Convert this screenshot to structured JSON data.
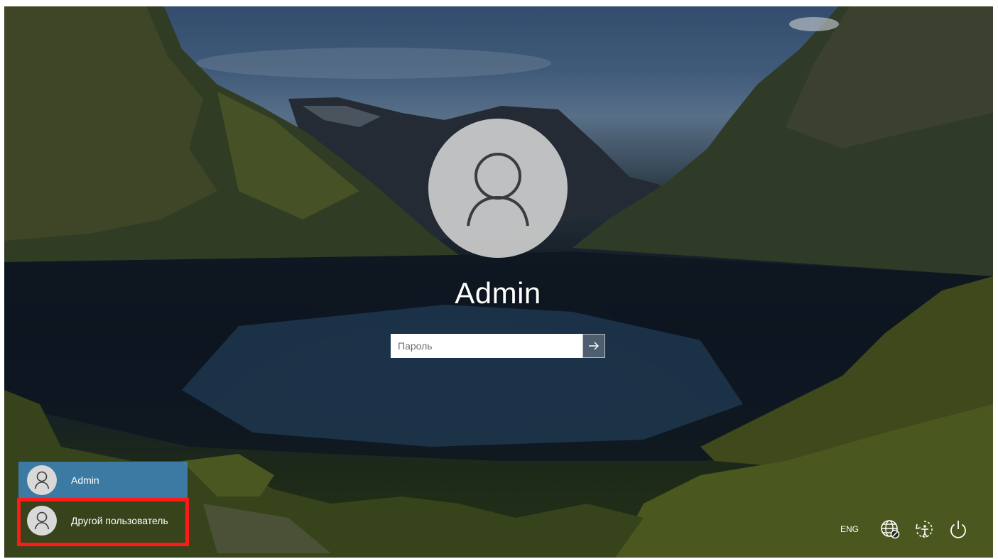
{
  "login": {
    "user_name": "Admin",
    "password_placeholder": "Пароль",
    "submit_icon": "arrow-right-icon"
  },
  "user_list": [
    {
      "label": "Admin",
      "selected": true,
      "icon": "user-avatar-icon"
    },
    {
      "label": "Другой пользователь",
      "selected": false,
      "icon": "user-avatar-icon"
    }
  ],
  "tray": {
    "language": "ENG",
    "icons": [
      "network-icon",
      "accessibility-icon",
      "power-icon"
    ]
  },
  "colors": {
    "highlight": "#ff1a1a",
    "selected_tile": "#408cd2"
  }
}
